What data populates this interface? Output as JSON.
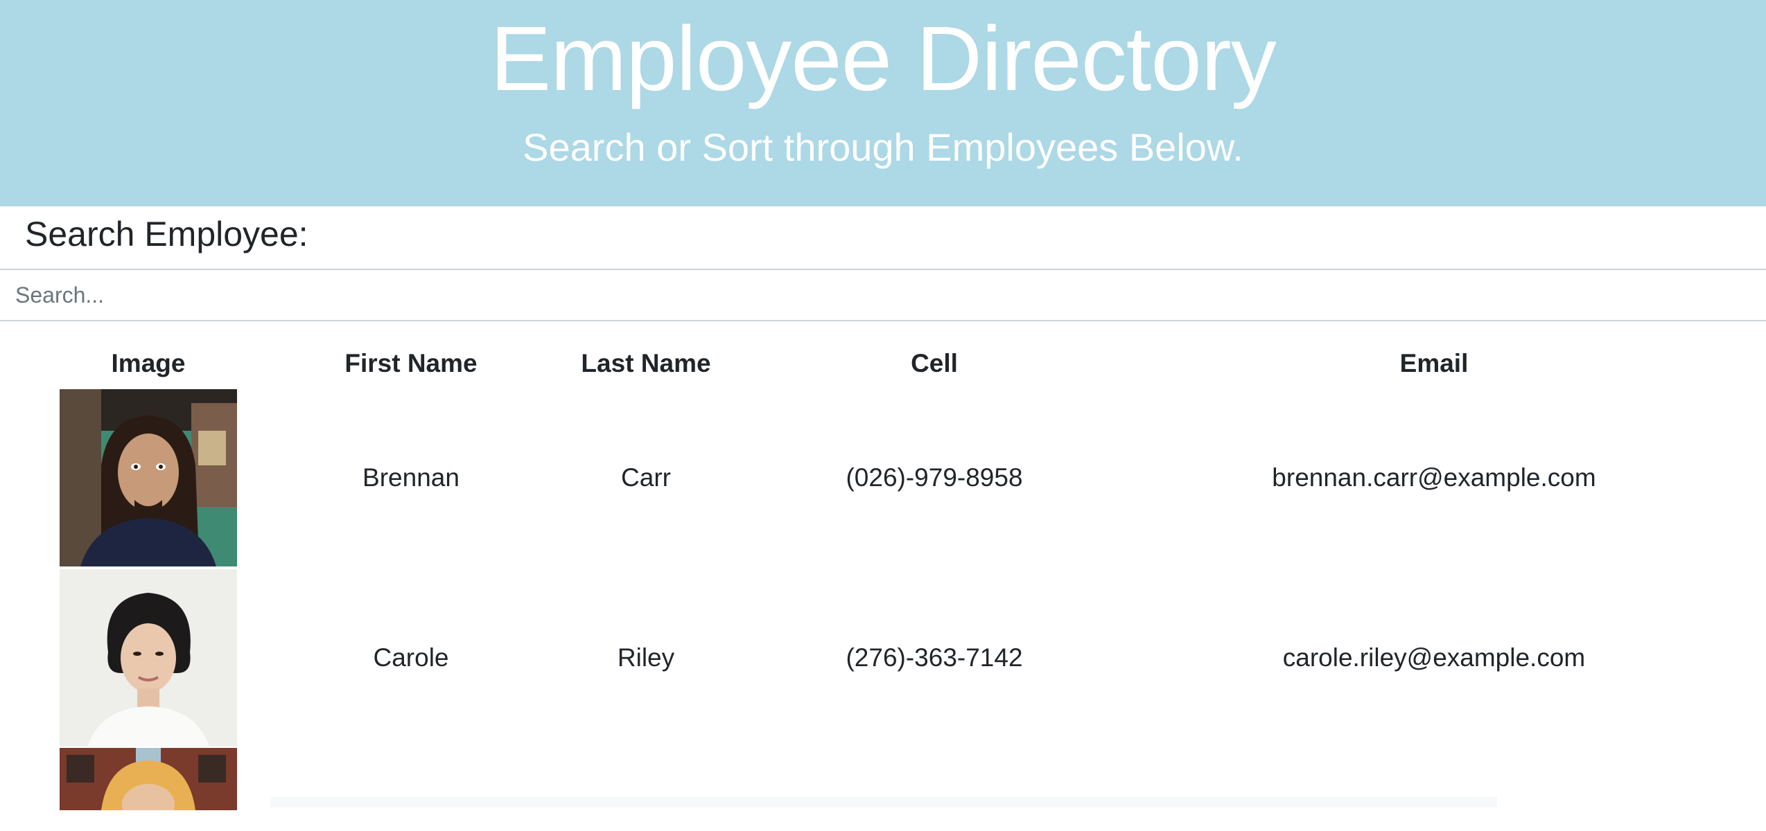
{
  "header": {
    "title": "Employee Directory",
    "subtitle": "Search or Sort through Employees Below."
  },
  "search": {
    "label": "Search Employee:",
    "placeholder": "Search...",
    "value": ""
  },
  "table": {
    "columns": [
      "Image",
      "First Name",
      "Last Name",
      "Cell",
      "Email"
    ],
    "rows": [
      {
        "first": "Brennan",
        "last": "Carr",
        "cell": "(026)-979-8958",
        "email": "brennan.carr@example.com"
      },
      {
        "first": "Carole",
        "last": "Riley",
        "cell": "(276)-363-7142",
        "email": "carole.riley@example.com"
      },
      {
        "first": "",
        "last": "",
        "cell": "",
        "email": ""
      }
    ]
  },
  "colors": {
    "header_bg": "#add8e6",
    "header_text": "#ffffff",
    "body_text": "#212529"
  }
}
